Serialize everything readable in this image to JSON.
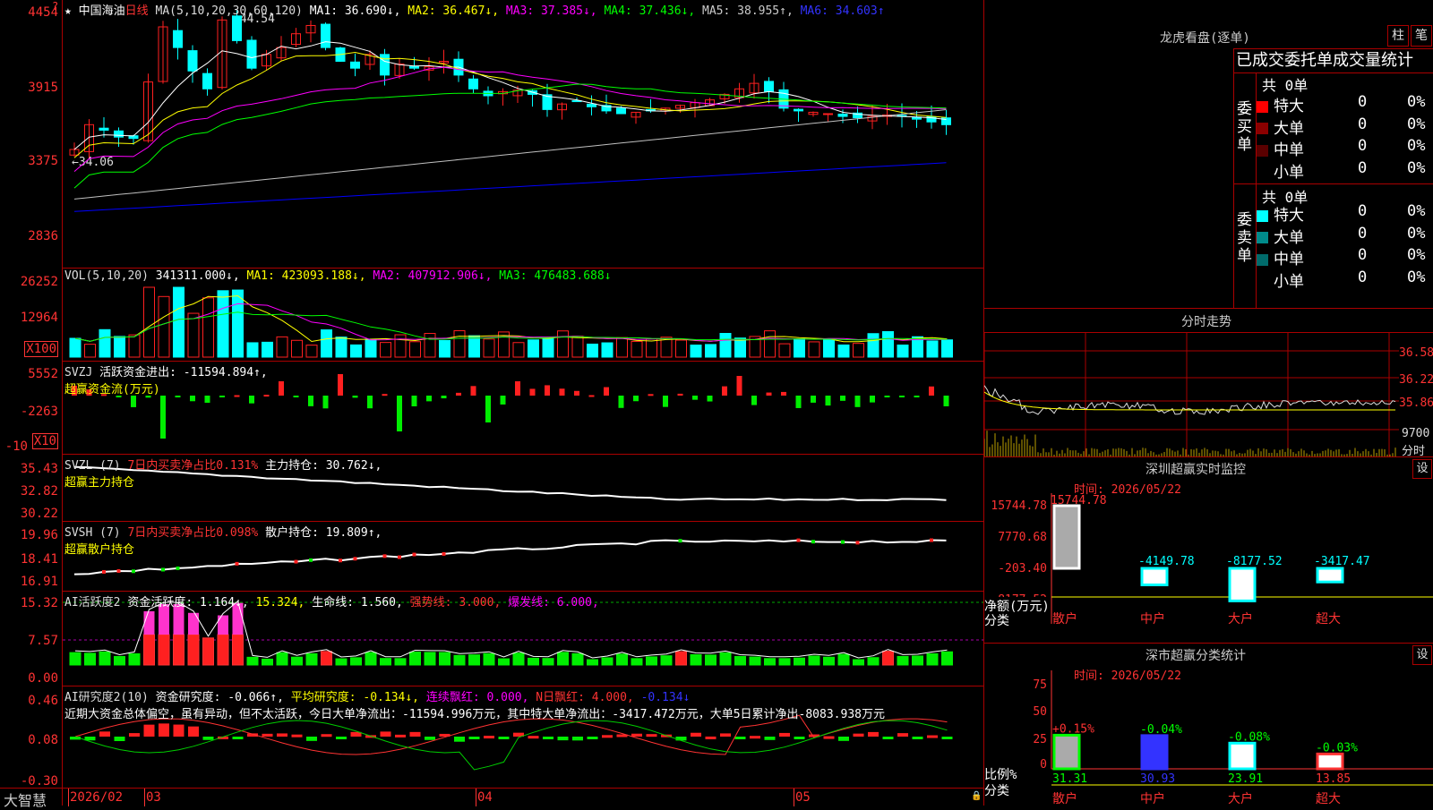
{
  "stock": {
    "name": "中国海油",
    "period": "日线",
    "marker": "★",
    "gear": "?"
  },
  "price_panel": {
    "ma_label": "MA(5,10,20,30,60,120)",
    "ma1": "MA1: 36.690↓,",
    "ma2": "MA2: 36.467↓,",
    "ma3": "MA3: 37.385↓,",
    "ma4": "MA4: 37.436↓,",
    "ma5": "MA5: 38.955↑,",
    "ma6": "MA6: 34.603↑",
    "high_mark": "44.54",
    "low_mark": "34.06",
    "yticks": [
      "4454",
      "3915",
      "3375",
      "2836"
    ]
  },
  "vol_panel": {
    "label": "VOL(5,10,20)",
    "value": "341311.000↓,",
    "ma1": "MA1: 423093.188↓,",
    "ma2": "MA2: 407912.906↓,",
    "ma3": "MA3: 476483.688↓",
    "yticks": [
      "26252",
      "12964",
      "X100"
    ]
  },
  "svzj_panel": {
    "label": "SVZJ",
    "title": "活跃资金进出: -11594.894↑,",
    "subtitle": "超赢资金流(万元)",
    "yticks": [
      "5552",
      "-2263",
      "-10",
      "X10"
    ]
  },
  "svzl_panel": {
    "label": "SVZL (7)",
    "ratio": "7日内买卖净占比0.131%",
    "hold": "主力持仓: 30.762↓,",
    "subtitle": "超赢主力持仓",
    "yticks": [
      "35.43",
      "32.82",
      "30.22"
    ]
  },
  "svsh_panel": {
    "label": "SVSH (7)",
    "ratio": "7日内买卖净占比0.098%",
    "hold": "散户持仓: 19.809↑,",
    "subtitle": "超赢散户持仓",
    "yticks": [
      "19.96",
      "18.41",
      "16.91"
    ]
  },
  "ai_active_panel": {
    "label": "AI活跃度2",
    "a": "资金活跃度: 1.164↓,",
    "b": "15.324,",
    "c": "生命线: 1.560,",
    "d": "强势线: 3.000,",
    "e": "爆发线: 6.000,",
    "yticks": [
      "15.32",
      "7.57",
      "0.00"
    ]
  },
  "ai_research_panel": {
    "label": "AI研究度2(10)",
    "a": "资金研究度: -0.066↑,",
    "b": "平均研究度: -0.134↓,",
    "c": "连续飘红: 0.000,",
    "d": "N日飘红: 4.000,",
    "e": "-0.134↓",
    "comment": "近期大资金总体偏空，虽有异动，但不太活跃，今日大单净流出：-11594.996万元，其中特大单净流出：-3417.472万元，大单5日累计净出-8083.938万元",
    "yticks": [
      "0.46",
      "0.08",
      "-0.30"
    ]
  },
  "date_axis": {
    "brand": "大智慧",
    "labels": [
      "2026/02",
      "03",
      "04",
      "05"
    ]
  },
  "dragon_tiger": {
    "title": "龙虎看盘(逐单)",
    "btn_col": "柱",
    "btn_pen": "笔",
    "stats_title": "已成交委托单成交量统计",
    "buy_label": "委买单",
    "buy_total": "共 0单",
    "buy_rows": [
      {
        "name": "特大",
        "count": "0",
        "pct": "0%",
        "color": "#ff0000"
      },
      {
        "name": "大单",
        "count": "0",
        "pct": "0%",
        "color": "#8b0000"
      },
      {
        "name": "中单",
        "count": "0",
        "pct": "0%",
        "color": "#5a0000"
      },
      {
        "name": "小单",
        "count": "0",
        "pct": "0%",
        "color": "#000000"
      }
    ],
    "sell_label": "委卖单",
    "sell_total": "共 0单",
    "sell_rows": [
      {
        "name": "特大",
        "count": "0",
        "pct": "0%",
        "color": "#00ffff"
      },
      {
        "name": "大单",
        "count": "0",
        "pct": "0%",
        "color": "#008b8b"
      },
      {
        "name": "中单",
        "count": "0",
        "pct": "0%",
        "color": "#006b6b"
      },
      {
        "name": "小单",
        "count": "0",
        "pct": "0%",
        "color": "#000000"
      }
    ]
  },
  "intraday": {
    "title": "分时走势",
    "prices": [
      "36.58",
      "36.22",
      "35.86"
    ],
    "vol": "9700",
    "unit": "分时"
  },
  "sz_monitor": {
    "title": "深圳超赢实时监控",
    "settings": "设",
    "time": "时间: 2026/05/22",
    "yticks": [
      "15744.78",
      "7770.68",
      "-203.40",
      "-8177.52"
    ],
    "values_label": [
      "15744.78",
      "-4149.78",
      "-8177.52",
      "-3417.47"
    ],
    "axis_title": "净额(万元)",
    "axis_sub": "分类",
    "categories": [
      "散户",
      "中户",
      "大户",
      "超大"
    ]
  },
  "sz_classify": {
    "title": "深市超赢分类统计",
    "settings": "设",
    "time": "时间: 2026/05/22",
    "yticks": [
      "75",
      "50",
      "25",
      "0"
    ],
    "changes": [
      "+0.15%",
      "-0.04%",
      "-0.08%",
      "-0.03%"
    ],
    "ratios": [
      "31.31",
      "30.93",
      "23.91",
      "13.85"
    ],
    "axis_title": "比例%",
    "axis_sub": "分类",
    "categories": [
      "散户",
      "中户",
      "大户",
      "超大"
    ]
  },
  "colors": {
    "up": "#ff2020",
    "down": "#00ffff",
    "grid": "#aa0000",
    "ma1": "#ffffff",
    "ma2": "#ffff00",
    "ma3": "#ff00ff",
    "ma4": "#00ff00",
    "ma5": "#c0c0c0",
    "ma6": "#0000ff"
  }
}
